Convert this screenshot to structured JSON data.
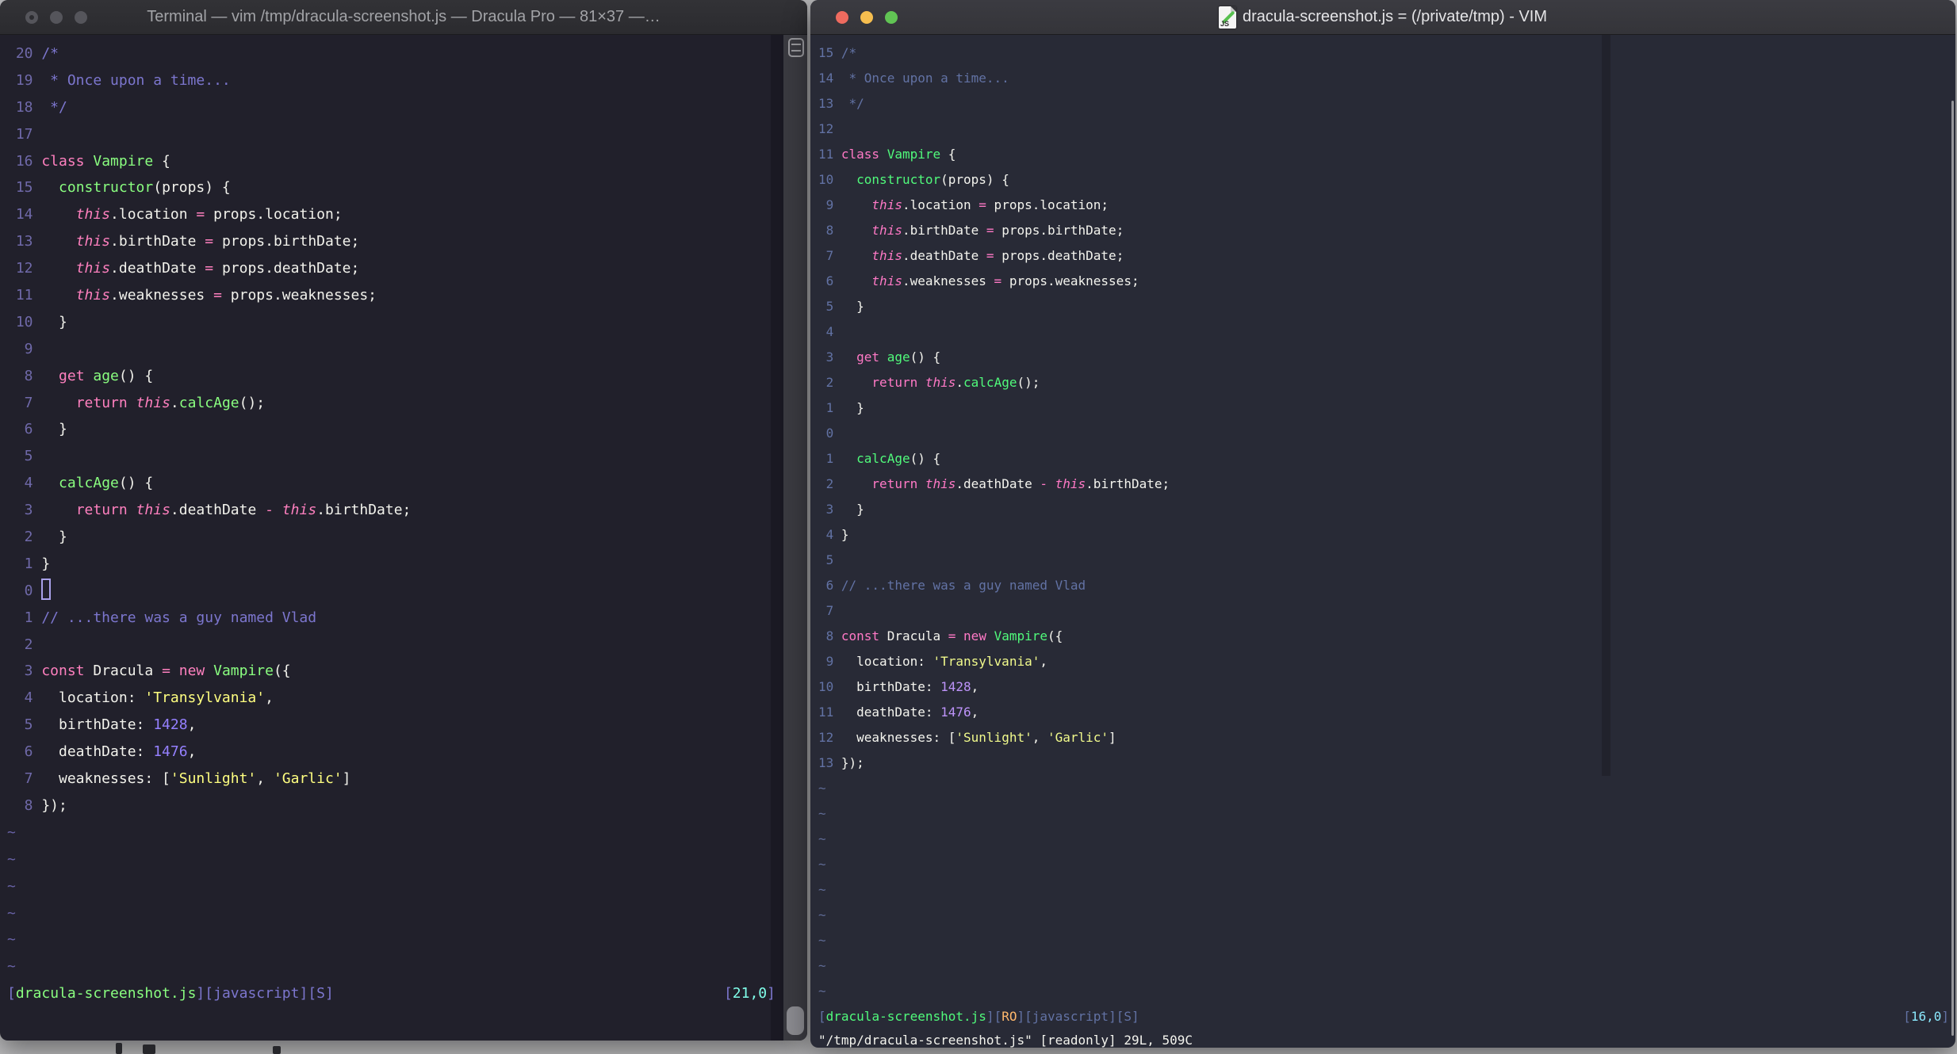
{
  "left": {
    "title": "Terminal — vim /tmp/dracula-screenshot.js — Dracula Pro — 81×37 —…",
    "theme_name": "Dracula Pro",
    "palette": {
      "bg": "#21202b",
      "fg": "#f2f2ec",
      "num": "#6f69a9",
      "c": "#7c76ce",
      "k": "#ff80bf",
      "f": "#8aff80",
      "s": "#ffff80",
      "n": "#9580ff",
      "br": "#7c76ce",
      "st": "#7c76ce",
      "cy": "#80ffea",
      "ro": "#ffca80",
      "tld": "#6761a5",
      "cur": "#a9a1ea"
    },
    "numbers": [
      "20",
      "19",
      "18",
      "17",
      "16",
      "15",
      "14",
      "13",
      "12",
      "11",
      "10",
      "9",
      "8",
      "7",
      "6",
      "5",
      "4",
      "3",
      "2",
      "1",
      "0",
      "1",
      "2",
      "3",
      "4",
      "5",
      "6",
      "7",
      "8"
    ],
    "cursor_line": 21,
    "tildes": 6,
    "status_left": [
      [
        "br",
        "["
      ],
      [
        "f",
        "dracula-screenshot.js"
      ],
      [
        "br",
        "]["
      ],
      [
        "st",
        "javascript"
      ],
      [
        "br",
        "]["
      ],
      [
        "st",
        "S"
      ],
      [
        "br",
        "]"
      ]
    ],
    "status_right": [
      [
        "br",
        "["
      ],
      [
        "cy",
        "21,0"
      ],
      [
        "br",
        "]"
      ]
    ],
    "cursor_position": "21,0"
  },
  "right": {
    "title": "dracula-screenshot.js = (/private/tmp) - VIM",
    "file_icon": "javascript-file-icon",
    "palette": {
      "bg": "#282a36",
      "fg": "#f4f4ee",
      "num": "#6272a4",
      "c": "#6272a4",
      "k": "#ff79c6",
      "f": "#50fa7b",
      "s": "#f1fa8c",
      "n": "#bd93f9",
      "br": "#6272a4",
      "st": "#6272a4",
      "cy": "#8be9fd",
      "ro": "#ffb86c",
      "tld": "#5e6a94",
      "cur": "#bd93f9"
    },
    "numbers": [
      "15",
      "14",
      "13",
      "12",
      "11",
      "10",
      "9",
      "8",
      "7",
      "6",
      "5",
      "4",
      "3",
      "2",
      "1",
      "0",
      "1",
      "2",
      "3",
      "4",
      "5",
      "6",
      "7",
      "8",
      "9",
      "10",
      "11",
      "12",
      "13"
    ],
    "cursor_line": null,
    "tildes": 9,
    "status_left": [
      [
        "br",
        "["
      ],
      [
        "f",
        "dracula-screenshot.js"
      ],
      [
        "br",
        "]["
      ],
      [
        "ro",
        "RO"
      ],
      [
        "br",
        "]["
      ],
      [
        "st",
        "javascript"
      ],
      [
        "br",
        "]["
      ],
      [
        "st",
        "S"
      ],
      [
        "br",
        "]"
      ]
    ],
    "status_right": [
      [
        "br",
        "["
      ],
      [
        "cy",
        "16,0"
      ],
      [
        "br",
        "]"
      ]
    ],
    "message": "\"/tmp/dracula-screenshot.js\" [readonly] 29L, 509C",
    "cursor_position": "16,0",
    "traffic_colors": {
      "close": "#ee6b5f",
      "minimize": "#f6be4f",
      "zoom": "#61c454"
    }
  },
  "code": {
    "file_name": "dracula-screenshot.js",
    "lines": [
      [
        [
          "c",
          "/*"
        ]
      ],
      [
        [
          "c",
          " * Once upon a time..."
        ]
      ],
      [
        [
          "c",
          " */"
        ]
      ],
      [],
      [
        [
          "k",
          "class"
        ],
        [
          "p",
          " "
        ],
        [
          "f",
          "Vampire"
        ],
        [
          "p",
          " {"
        ]
      ],
      [
        [
          "p",
          "  "
        ],
        [
          "f",
          "constructor"
        ],
        [
          "p",
          "(props) {"
        ]
      ],
      [
        [
          "p",
          "    "
        ],
        [
          "t",
          "this"
        ],
        [
          "p",
          ".location "
        ],
        [
          "o",
          "="
        ],
        [
          "p",
          " props.location;"
        ]
      ],
      [
        [
          "p",
          "    "
        ],
        [
          "t",
          "this"
        ],
        [
          "p",
          ".birthDate "
        ],
        [
          "o",
          "="
        ],
        [
          "p",
          " props.birthDate;"
        ]
      ],
      [
        [
          "p",
          "    "
        ],
        [
          "t",
          "this"
        ],
        [
          "p",
          ".deathDate "
        ],
        [
          "o",
          "="
        ],
        [
          "p",
          " props.deathDate;"
        ]
      ],
      [
        [
          "p",
          "    "
        ],
        [
          "t",
          "this"
        ],
        [
          "p",
          ".weaknesses "
        ],
        [
          "o",
          "="
        ],
        [
          "p",
          " props.weaknesses;"
        ]
      ],
      [
        [
          "p",
          "  }"
        ]
      ],
      [],
      [
        [
          "p",
          "  "
        ],
        [
          "k",
          "get"
        ],
        [
          "p",
          " "
        ],
        [
          "f",
          "age"
        ],
        [
          "p",
          "() {"
        ]
      ],
      [
        [
          "p",
          "    "
        ],
        [
          "k",
          "return"
        ],
        [
          "p",
          " "
        ],
        [
          "t",
          "this"
        ],
        [
          "p",
          "."
        ],
        [
          "f",
          "calcAge"
        ],
        [
          "p",
          "();"
        ]
      ],
      [
        [
          "p",
          "  }"
        ]
      ],
      [],
      [
        [
          "p",
          "  "
        ],
        [
          "f",
          "calcAge"
        ],
        [
          "p",
          "() {"
        ]
      ],
      [
        [
          "p",
          "    "
        ],
        [
          "k",
          "return"
        ],
        [
          "p",
          " "
        ],
        [
          "t",
          "this"
        ],
        [
          "p",
          ".deathDate "
        ],
        [
          "o",
          "-"
        ],
        [
          "p",
          " "
        ],
        [
          "t",
          "this"
        ],
        [
          "p",
          ".birthDate;"
        ]
      ],
      [
        [
          "p",
          "  }"
        ]
      ],
      [
        [
          "p",
          "}"
        ]
      ],
      [],
      [
        [
          "c",
          "// ...there was a guy named Vlad"
        ]
      ],
      [],
      [
        [
          "k",
          "const"
        ],
        [
          "p",
          " Dracula "
        ],
        [
          "o",
          "="
        ],
        [
          "p",
          " "
        ],
        [
          "k",
          "new"
        ],
        [
          "p",
          " "
        ],
        [
          "f",
          "Vampire"
        ],
        [
          "p",
          "({"
        ]
      ],
      [
        [
          "p",
          "  location: "
        ],
        [
          "s",
          "'Transylvania'"
        ],
        [
          "p",
          ","
        ]
      ],
      [
        [
          "p",
          "  birthDate: "
        ],
        [
          "n",
          "1428"
        ],
        [
          "p",
          ","
        ]
      ],
      [
        [
          "p",
          "  deathDate: "
        ],
        [
          "n",
          "1476"
        ],
        [
          "p",
          ","
        ]
      ],
      [
        [
          "p",
          "  weaknesses: ["
        ],
        [
          "s",
          "'Sunlight'"
        ],
        [
          "p",
          ", "
        ],
        [
          "s",
          "'Garlic'"
        ],
        [
          "p",
          "]"
        ]
      ],
      [
        [
          "p",
          "});"
        ]
      ]
    ]
  }
}
